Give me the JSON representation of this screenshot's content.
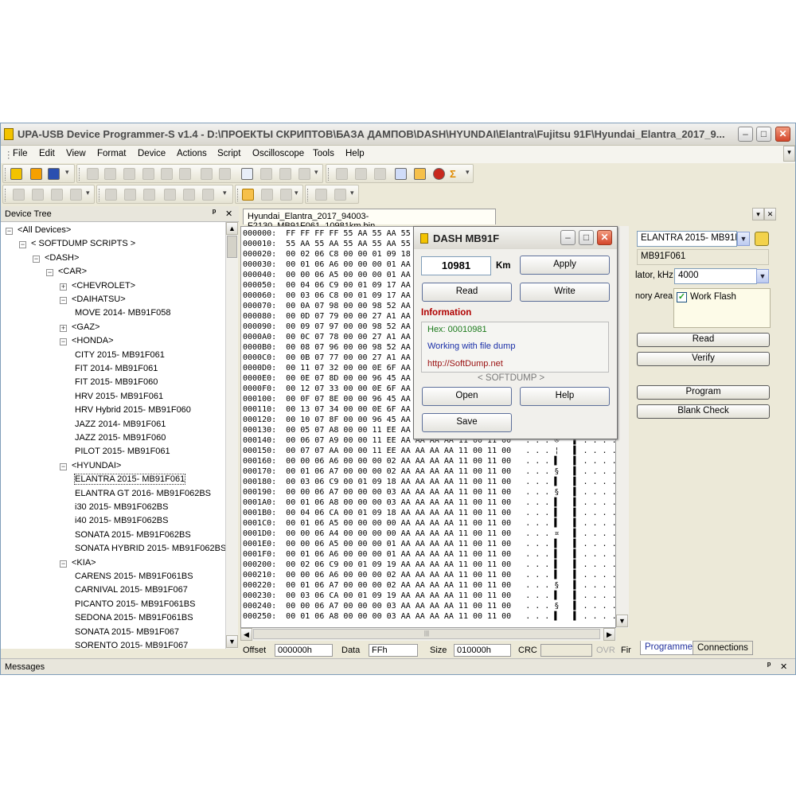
{
  "window": {
    "title": "UPA-USB Device Programmer-S v1.4 - D:\\ПРОЕКТЫ СКРИПТОВ\\БАЗА ДАМПОВ\\DASH\\HYUNDAI\\Elantra\\Fujitsu 91F\\Hyundai_Elantra_2017_9...",
    "min": "–",
    "max": "□",
    "close": "✕"
  },
  "menu": [
    "File",
    "Edit",
    "View",
    "Format",
    "Device",
    "Actions",
    "Script",
    "Oscilloscope",
    "Tools",
    "Help"
  ],
  "device_tree": {
    "title": "Device Tree",
    "pin": "ᵖ",
    "close": "✕",
    "nodes": [
      {
        "label": "<All Devices>",
        "exp": "−"
      },
      {
        "label": "< SOFTDUMP SCRIPTS >",
        "exp": "−"
      },
      {
        "label": "<DASH>",
        "exp": "−"
      },
      {
        "label": "<CAR>",
        "exp": "−"
      },
      {
        "label": "<CHEVROLET>",
        "exp": "+"
      },
      {
        "label": "<DAIHATSU>",
        "exp": "−"
      },
      {
        "label": "MOVE 2014- MB91F058",
        "exp": ""
      },
      {
        "label": "<GAZ>",
        "exp": "+"
      },
      {
        "label": "<HONDA>",
        "exp": "−"
      },
      {
        "label": "CITY 2015- MB91F061",
        "exp": ""
      },
      {
        "label": "FIT 2014- MB91F061",
        "exp": ""
      },
      {
        "label": "FIT 2015- MB91F060",
        "exp": ""
      },
      {
        "label": "HRV 2015- MB91F061",
        "exp": ""
      },
      {
        "label": "HRV Hybrid 2015- MB91F060",
        "exp": ""
      },
      {
        "label": "JAZZ 2014- MB91F061",
        "exp": ""
      },
      {
        "label": "JAZZ 2015- MB91F060",
        "exp": ""
      },
      {
        "label": "PILOT 2015- MB91F061",
        "exp": ""
      },
      {
        "label": "<HYUNDAI>",
        "exp": "−"
      },
      {
        "label": "ELANTRA 2015- MB91F061",
        "exp": ""
      },
      {
        "label": "ELANTRA GT 2016- MB91F062BS",
        "exp": ""
      },
      {
        "label": "i30 2015- MB91F062BS",
        "exp": ""
      },
      {
        "label": "i40 2015- MB91F062BS",
        "exp": ""
      },
      {
        "label": "SONATA 2015- MB91F062BS",
        "exp": ""
      },
      {
        "label": "SONATA HYBRID 2015- MB91F062BS",
        "exp": ""
      },
      {
        "label": "<KIA>",
        "exp": "−"
      },
      {
        "label": "CARENS 2015- MB91F061BS",
        "exp": ""
      },
      {
        "label": "CARNIVAL 2015- MB91F067",
        "exp": ""
      },
      {
        "label": "PICANTO 2015- MB91F061BS",
        "exp": ""
      },
      {
        "label": "SEDONA 2015- MB91F061BS",
        "exp": ""
      },
      {
        "label": "SONATA 2015- MB91F067",
        "exp": ""
      },
      {
        "label": "SORENTO 2015- MB91F067",
        "exp": ""
      },
      {
        "label": "<TRUCK>",
        "exp": "+"
      }
    ]
  },
  "doc_tab": "Hyundai_Elantra_2017_94003-F2130_MB91F061_10981km.bin",
  "hex_rows": [
    "000000:  FF FF FF FF 55 AA 55 AA 55",
    "000010:  55 AA 55 AA 55 AA 55 AA 55",
    "000020:  00 02 06 C8 00 00 01 09 18 AA",
    "000030:  00 01 06 A6 00 00 00 01 AA",
    "000040:  00 00 06 A5 00 00 00 01 AA",
    "000050:  00 04 06 C9 00 01 09 17 AA",
    "000060:  00 03 06 C8 00 01 09 17 AA",
    "000070:  00 0A 07 98 00 00 98 52 AA",
    "000080:  00 0D 07 79 00 00 27 A1 AA",
    "000090:  00 09 07 97 00 00 98 52 AA",
    "0000A0:  00 0C 07 78 00 00 27 A1 AA",
    "0000B0:  00 08 07 96 00 00 98 52 AA",
    "0000C0:  00 0B 07 77 00 00 27 A1 AA",
    "0000D0:  00 11 07 32 00 00 0E 6F AA",
    "0000E0:  00 0E 07 8D 00 00 96 45 AA",
    "0000F0:  00 12 07 33 00 00 0E 6F AA",
    "000100:  00 0F 07 8E 00 00 96 45 AA",
    "000110:  00 13 07 34 00 00 0E 6F AA",
    "000120:  00 10 07 8F 00 00 96 45 AA",
    "000130:  00 05 07 A8 00 00 11 EE AA",
    "000140:  00 06 07 A9 00 00 11 EE AA AA AA AA 11 00 11 00   . . . ®   ▌ . . . . ▌▌▌",
    "000150:  00 07 07 AA 00 00 11 EE AA AA AA AA 11 00 11 00   . . . ¦   ▌ . . . . ▌▌▌",
    "000160:  00 00 06 A6 00 00 00 02 AA AA AA AA 11 00 11 00   . . . ▌   ▌ . . . . ▌▌▌",
    "000170:  00 01 06 A7 00 00 00 02 AA AA AA AA 11 00 11 00   . . . §   ▌ . . . . ▌▌▌",
    "000180:  00 03 06 C9 00 01 09 18 AA AA AA AA 11 00 11 00   . . . ▌   ▌ . . . . ▌▌▌",
    "000190:  00 00 06 A7 00 00 00 03 AA AA AA AA 11 00 11 00   . . . §   ▌ . . . . ▌▌▌",
    "0001A0:  00 01 06 A8 00 00 00 03 AA AA AA AA 11 00 11 00   . . . ▌   ▌ . . . . ▌▌▌",
    "0001B0:  00 04 06 CA 00 01 09 18 AA AA AA AA 11 00 11 00   . . . ▌   ▌ . . . . ▌▌▌",
    "0001C0:  00 01 06 A5 00 00 00 00 AA AA AA AA 11 00 11 00   . . . ▌   ▌ . . . . ▌▌▌",
    "0001D0:  00 00 06 A4 00 00 00 00 AA AA AA AA 11 00 11 00   . . . ¤   ▌ . . . . ▌▌▌",
    "0001E0:  00 00 06 A5 00 00 00 01 AA AA AA AA 11 00 11 00   . . . ▌   ▌ . . . . ▌▌▌",
    "0001F0:  00 01 06 A6 00 00 00 01 AA AA AA AA 11 00 11 00   . . . ▌   ▌ . . . . ▌▌▌",
    "000200:  00 02 06 C9 00 01 09 19 AA AA AA AA 11 00 11 00   . . . ▌   ▌ . . . . ▌▌▌",
    "000210:  00 00 06 A6 00 00 00 02 AA AA AA AA 11 00 11 00   . . . ▌   ▌ . . . . ▌▌▌",
    "000220:  00 01 06 A7 00 00 00 02 AA AA AA AA 11 00 11 00   . . . §   ▌ . . . . ▌▌▌",
    "000230:  00 03 06 CA 00 01 09 19 AA AA AA AA 11 00 11 00   . . . ▌   ▌ . . . . ▌▌▌",
    "000240:  00 00 06 A7 00 00 00 03 AA AA AA AA 11 00 11 00   . . . §   ▌ . . . . ▌▌▌",
    "000250:  00 01 06 A8 00 00 00 03 AA AA AA AA 11 00 11 00   . . . ▌   ▌ . . . . ▌▌▌"
  ],
  "status": {
    "offset_label": "Offset",
    "offset_value": "000000h",
    "data_label": "Data",
    "data_value": "FFh",
    "size_label": "Size",
    "size_value": "010000h",
    "crc_label": "CRC",
    "ovr": "OVR",
    "fir": "Fir"
  },
  "right_panel": {
    "device_select": "ELANTRA 2015- MB91F",
    "chip": "MB91F061",
    "osc_label": "lator, kHz",
    "osc_value": "4000",
    "memory_area_label": "nory Area",
    "work_flash": "Work Flash",
    "work_flash_checked": "✓",
    "read": "Read",
    "verify": "Verify",
    "program": "Program",
    "blank_check": "Blank Check",
    "tab_programmer": "Programmer",
    "tab_connections": "Connections"
  },
  "messages": {
    "title": "Messages",
    "pin": "ᵖ",
    "close": "✕"
  },
  "dialog": {
    "title": "DASH MB91F",
    "km_value": "10981",
    "km_unit": "Km",
    "apply": "Apply",
    "read": "Read",
    "write": "Write",
    "info_title": "Information",
    "hex_line": "Hex: 00010981",
    "status_line": "Working with file dump",
    "url": "http://SoftDump.net",
    "brand": "< SOFTDUMP >",
    "open": "Open",
    "help": "Help",
    "save": "Save"
  },
  "colors": {
    "accent_orange": "#f6a000",
    "info_red": "#b00000",
    "hex_green": "#1b7a1b",
    "status_blue": "#1a2fa8",
    "url_red": "#9a1010"
  }
}
